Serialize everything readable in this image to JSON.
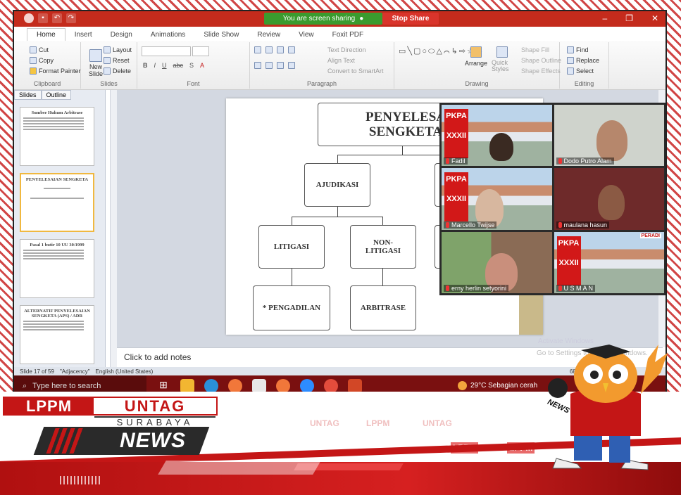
{
  "ppt": {
    "share_status": "You are screen sharing",
    "stop_share": "Stop Share",
    "tabs": [
      "Home",
      "Insert",
      "Design",
      "Animations",
      "Slide Show",
      "Review",
      "View",
      "Foxit PDF"
    ],
    "clipboard": {
      "cut": "Cut",
      "copy": "Copy",
      "format_painter": "Format Painter",
      "caption": "Clipboard"
    },
    "slides": {
      "new_slide": "New Slide",
      "layout": "Layout",
      "reset": "Reset",
      "delete": "Delete",
      "caption": "Slides"
    },
    "font_caption": "Font",
    "paragraph": {
      "text_direction": "Text Direction",
      "align_text": "Align Text",
      "convert": "Convert to SmartArt",
      "caption": "Paragraph"
    },
    "drawing": {
      "arrange": "Arrange",
      "quick_styles": "Quick Styles",
      "shape_fill": "Shape Fill",
      "shape_outline": "Shape Outline",
      "shape_effects": "Shape Effects",
      "caption": "Drawing"
    },
    "editing": {
      "find": "Find",
      "replace": "Replace",
      "select": "Select",
      "caption": "Editing"
    },
    "pane_tabs": [
      "Slides",
      "Outline"
    ],
    "thumbnails": [
      {
        "title": "Sumber Hukum Arbitrase"
      },
      {
        "title": "PENYELESAIAN SENGKETA"
      },
      {
        "title": "Pasal 1 butir 10 UU 30/1999"
      },
      {
        "title": "ALTERNATIF PENYELESAIAN SENGKETA (APS) / ADR"
      }
    ],
    "slide": {
      "title_line1": "PENYELESA",
      "title_line2": "SENGKETA",
      "node_ajudikasi": "AJUDIKASI",
      "node_litigasi": "LITIGASI",
      "node_nonlitigasi": "NON-\nLITIGASI",
      "node_pengadilan": "* PENGADILAN",
      "node_arbitrase": "ARBITRASE"
    },
    "notes_placeholder": "Click to add notes",
    "status": {
      "slide": "Slide 17 of 59",
      "theme": "\"Adjacency\"",
      "language": "English (United States)",
      "zoom": "68%"
    }
  },
  "taskbar": {
    "search_placeholder": "Type here to search",
    "weather": "29°C  Sebagian cerah"
  },
  "activate_watermark": {
    "line1": "Activate Windows",
    "line2": "Go to Settings to activate Windows."
  },
  "participants": [
    {
      "name": "Fadil"
    },
    {
      "name": "Dodo Putro Alam"
    },
    {
      "name": "Marcello Twijse"
    },
    {
      "name": "maulana hasun"
    },
    {
      "name": "erny herlin setyorini"
    },
    {
      "name": "U S M A N"
    }
  ],
  "pkpa": {
    "line1": "PKPA",
    "line2": "XXXII",
    "peradi": "PERADI"
  },
  "branding": {
    "lppm": "LPPM",
    "untag": "UNTAG",
    "surabaya": "SURABAYA",
    "news": "NEWS",
    "mascot_mic": "NEWS"
  },
  "colors": {
    "brand_red": "#c41616",
    "share_green": "#3a9b2e",
    "title_red": "#c42b1c"
  }
}
